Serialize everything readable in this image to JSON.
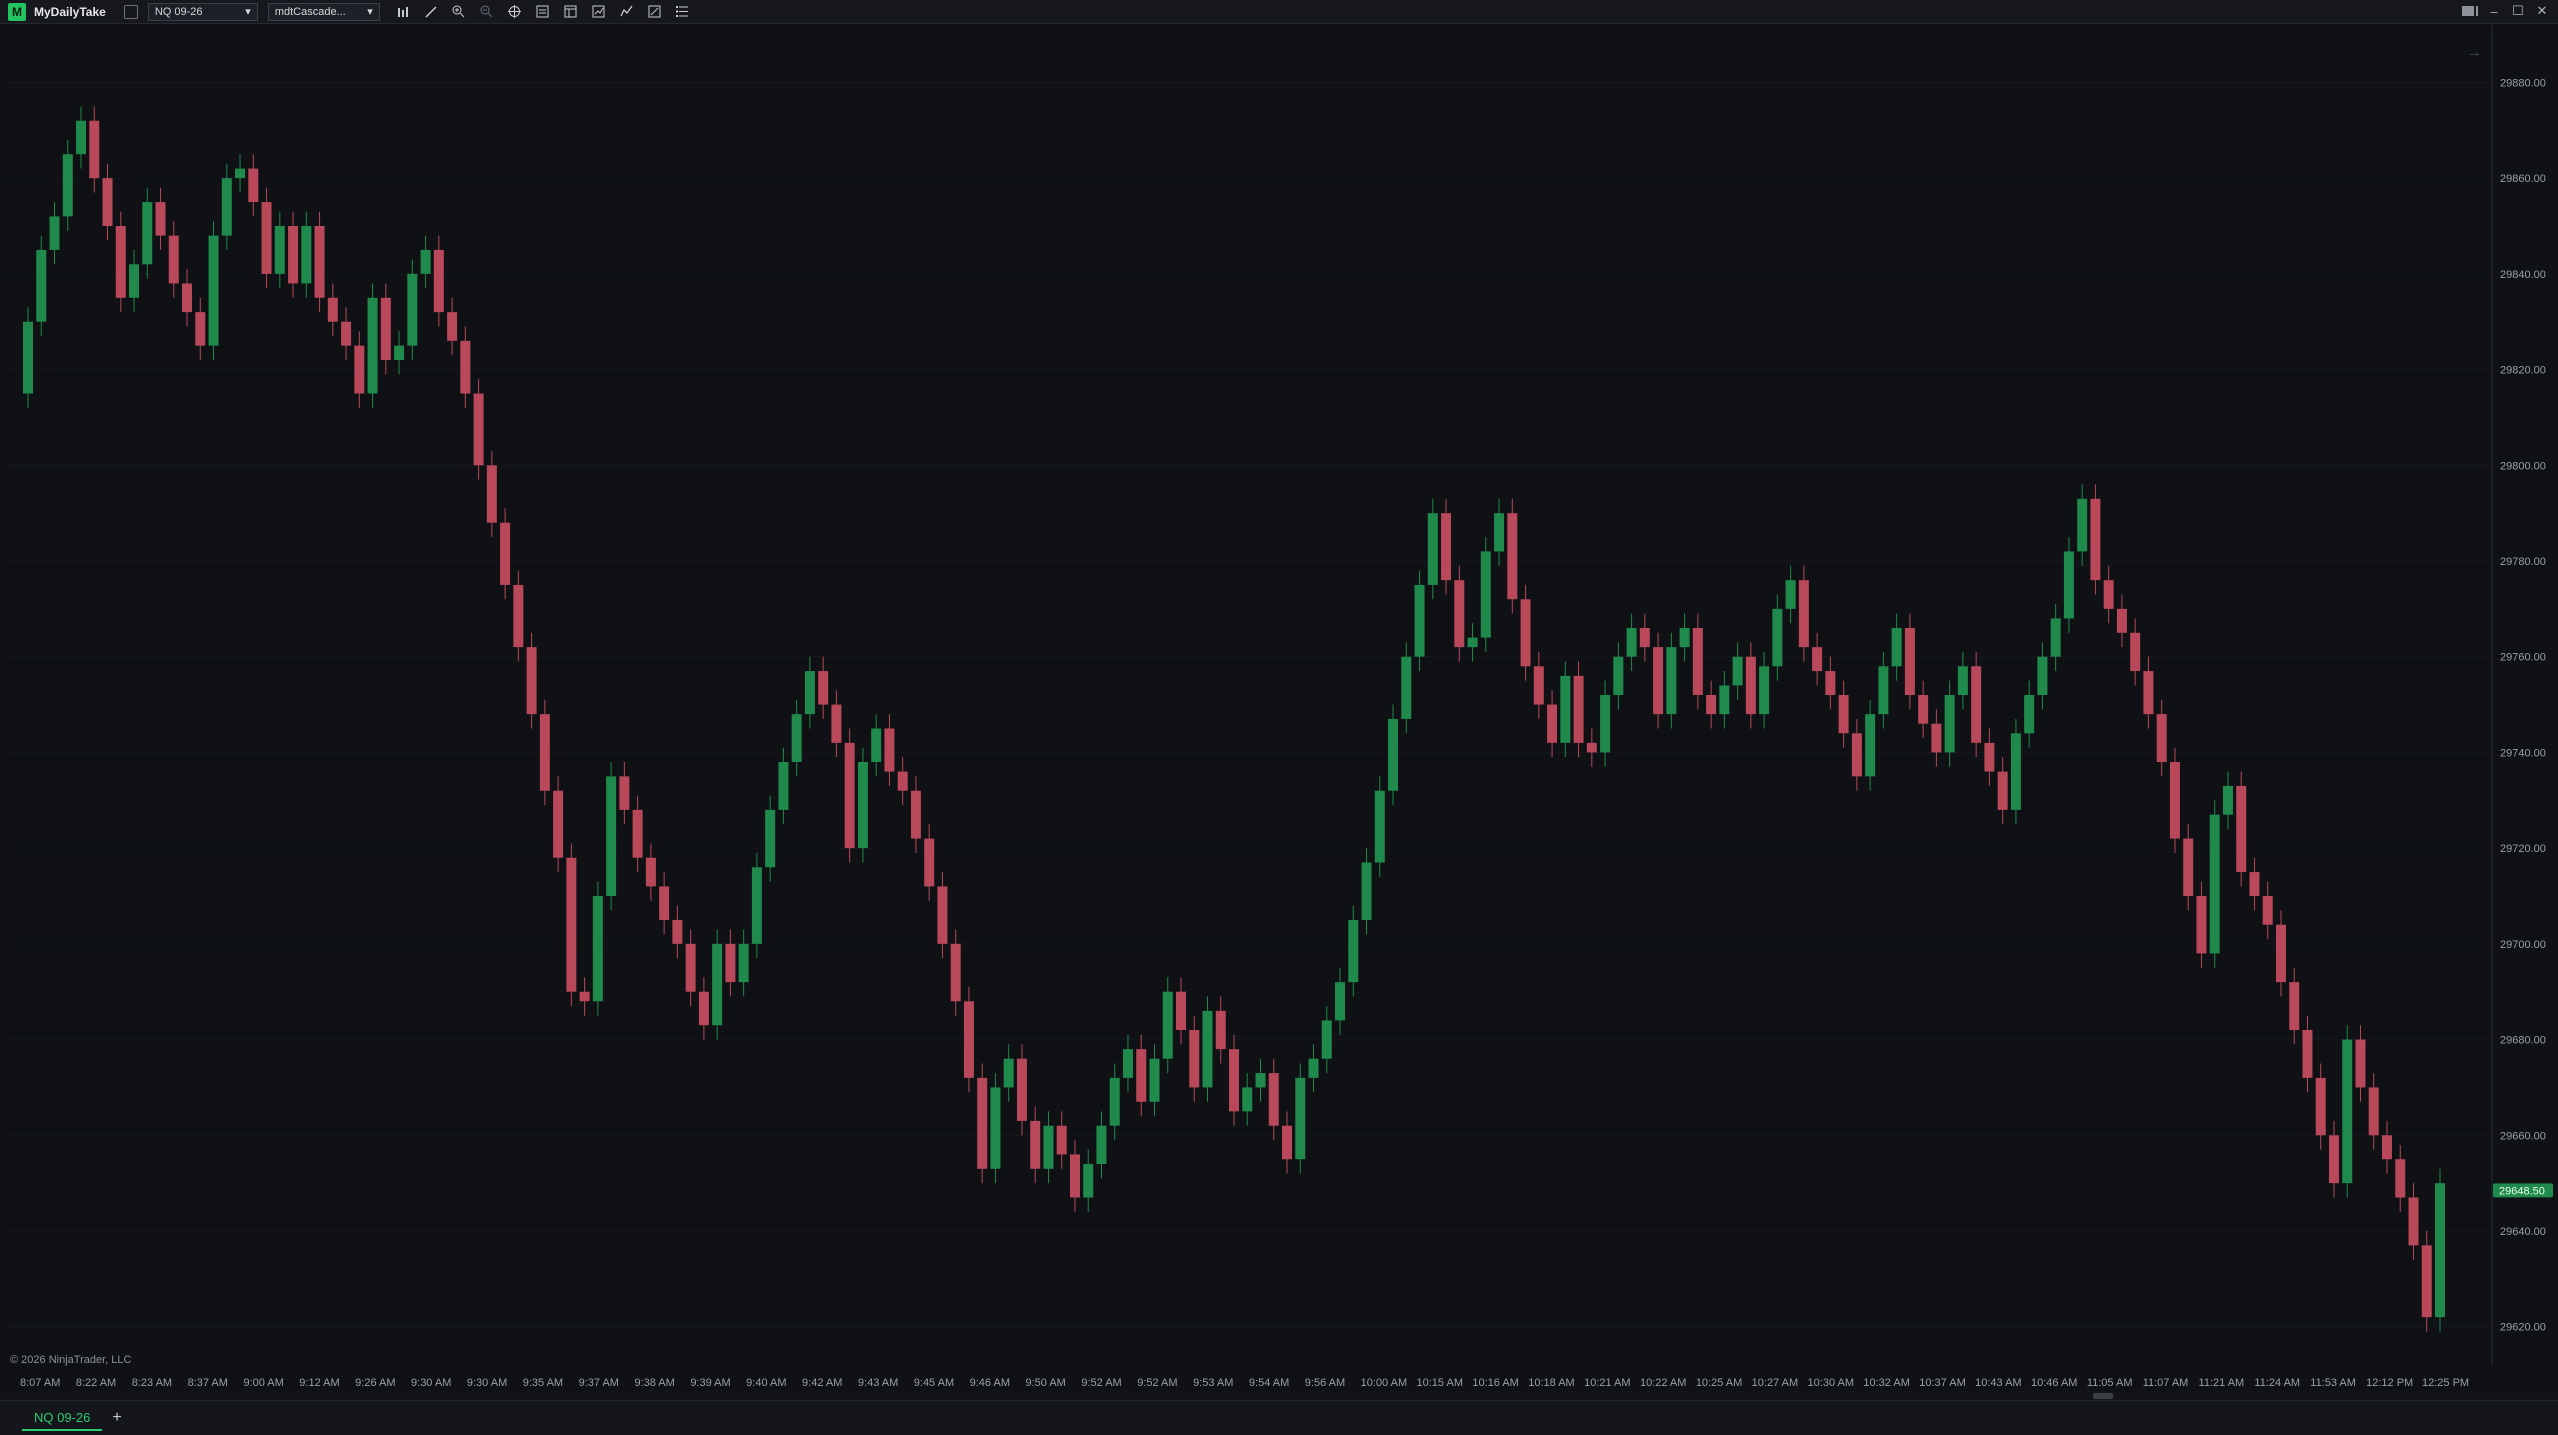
{
  "app": {
    "name": "MyDailyTake",
    "logo": "M"
  },
  "toolbar": {
    "instrument": "NQ 09-26",
    "template": "mdtCascade...",
    "icons": [
      "bar-type-icon",
      "draw-tool-icon",
      "zoom-in-icon",
      "zoom-out-icon",
      "crosshair-icon",
      "data-box-icon",
      "properties-icon",
      "chart-trader-icon",
      "indicators-icon",
      "strategies-icon",
      "list-icon"
    ]
  },
  "window": {
    "icons": [
      "tile-layout-icon",
      "minimize-icon",
      "maximize-icon",
      "close-icon"
    ]
  },
  "chart": {
    "copyright": "© 2026 NinjaTrader, LLC",
    "current_price": "29648.50",
    "colors": {
      "up": "#1f8a4c",
      "down": "#b8485a",
      "background": "#0f1115",
      "price_tag": "#1f8a4c"
    }
  },
  "bottom": {
    "tab": "NQ 09-26",
    "add": "+"
  },
  "chart_data": {
    "type": "candlestick",
    "ylim": [
      29612,
      29892
    ],
    "y_ticks": [
      "29880.00",
      "29860.00",
      "29840.00",
      "29820.00",
      "29800.00",
      "29780.00",
      "29760.00",
      "29740.00",
      "29720.00",
      "29700.00",
      "29680.00",
      "29660.00",
      "29640.00",
      "29620.00"
    ],
    "y_tick_values": [
      29880,
      29860,
      29840,
      29820,
      29800,
      29780,
      29760,
      29740,
      29720,
      29700,
      29680,
      29660,
      29640,
      29620
    ],
    "x_labels": [
      "8:07 AM",
      "8:22 AM",
      "8:23 AM",
      "8:37 AM",
      "9:00 AM",
      "9:12 AM",
      "9:26 AM",
      "9:30 AM",
      "9:30 AM",
      "9:35 AM",
      "9:37 AM",
      "9:38 AM",
      "9:39 AM",
      "9:40 AM",
      "9:42 AM",
      "9:43 AM",
      "9:45 AM",
      "9:46 AM",
      "9:50 AM",
      "9:52 AM",
      "9:52 AM",
      "9:53 AM",
      "9:54 AM",
      "9:56 AM",
      "10:00 AM",
      "10:15 AM",
      "10:16 AM",
      "10:18 AM",
      "10:21 AM",
      "10:22 AM",
      "10:25 AM",
      "10:27 AM",
      "10:30 AM",
      "10:32 AM",
      "10:37 AM",
      "10:43 AM",
      "10:46 AM",
      "11:05 AM",
      "11:07 AM",
      "11:21 AM",
      "11:24 AM",
      "11:53 AM",
      "12:12 PM",
      "12:25 PM"
    ],
    "closes": [
      29830,
      29845,
      29852,
      29865,
      29872,
      29860,
      29850,
      29835,
      29842,
      29855,
      29848,
      29838,
      29832,
      29825,
      29848,
      29860,
      29862,
      29855,
      29840,
      29850,
      29838,
      29850,
      29835,
      29830,
      29825,
      29815,
      29835,
      29822,
      29825,
      29840,
      29845,
      29832,
      29826,
      29815,
      29800,
      29788,
      29775,
      29762,
      29748,
      29732,
      29718,
      29690,
      29688,
      29710,
      29735,
      29728,
      29718,
      29712,
      29705,
      29700,
      29690,
      29683,
      29700,
      29692,
      29700,
      29716,
      29728,
      29738,
      29748,
      29757,
      29750,
      29742,
      29720,
      29738,
      29745,
      29736,
      29732,
      29722,
      29712,
      29700,
      29688,
      29672,
      29653,
      29670,
      29676,
      29663,
      29653,
      29662,
      29656,
      29647,
      29654,
      29662,
      29672,
      29678,
      29667,
      29676,
      29690,
      29682,
      29670,
      29686,
      29678,
      29665,
      29670,
      29673,
      29662,
      29655,
      29672,
      29676,
      29684,
      29692,
      29705,
      29717,
      29732,
      29747,
      29760,
      29775,
      29790,
      29776,
      29762,
      29764,
      29782,
      29790,
      29772,
      29758,
      29750,
      29742,
      29756,
      29742,
      29740,
      29752,
      29760,
      29766,
      29762,
      29748,
      29762,
      29766,
      29752,
      29748,
      29754,
      29760,
      29748,
      29758,
      29770,
      29776,
      29762,
      29757,
      29752,
      29744,
      29735,
      29748,
      29758,
      29766,
      29752,
      29746,
      29740,
      29752,
      29758,
      29742,
      29736,
      29728,
      29744,
      29752,
      29760,
      29768,
      29782,
      29793,
      29776,
      29770,
      29765,
      29757,
      29748,
      29738,
      29722,
      29710,
      29698,
      29727,
      29733,
      29715,
      29710,
      29704,
      29692,
      29682,
      29672,
      29660,
      29650,
      29680,
      29670,
      29660,
      29655,
      29647,
      29637,
      29622,
      29650
    ]
  }
}
